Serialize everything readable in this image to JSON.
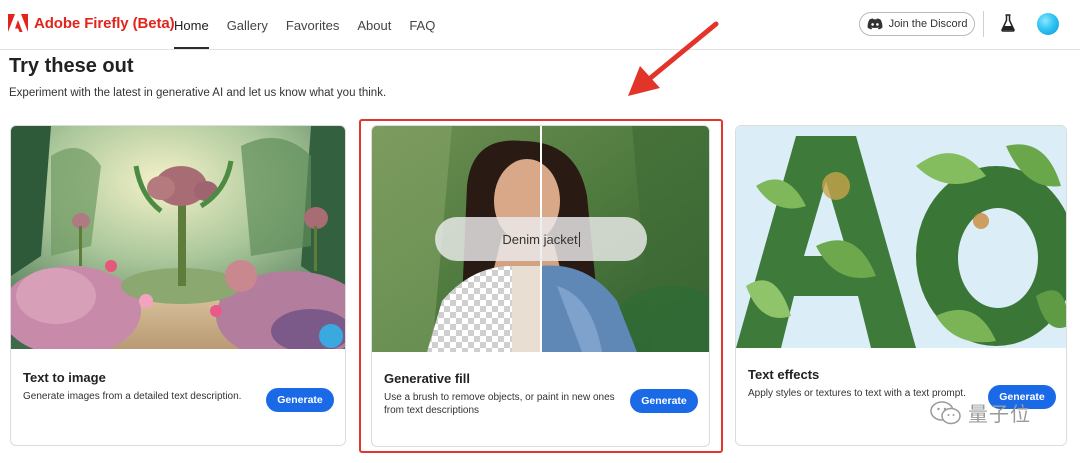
{
  "header": {
    "brand": "Adobe Firefly (Beta)",
    "nav": [
      {
        "label": "Home",
        "active": true
      },
      {
        "label": "Gallery",
        "active": false
      },
      {
        "label": "Favorites",
        "active": false
      },
      {
        "label": "About",
        "active": false
      },
      {
        "label": "FAQ",
        "active": false
      }
    ],
    "discord_label": "Join the Discord",
    "icons": [
      "adobe-logo-icon",
      "discord-icon",
      "flask-icon",
      "avatar"
    ]
  },
  "main": {
    "title": "Try these out",
    "subtitle": "Experiment with the latest in generative AI and let us know what you think."
  },
  "cards": [
    {
      "title": "Text to image",
      "description": "Generate images from a detailed text description.",
      "button": "Generate"
    },
    {
      "title": "Generative fill",
      "description": "Use a brush to remove objects, or paint in new ones from text descriptions",
      "button": "Generate",
      "prompt_text": "Denim jacket"
    },
    {
      "title": "Text effects",
      "description": "Apply styles or textures to text with a text prompt.",
      "button": "Generate"
    }
  ],
  "watermark": "量子位",
  "colors": {
    "brand_red": "#e1251b",
    "primary_blue": "#1a6ae8",
    "highlight_red": "#e0362c"
  }
}
